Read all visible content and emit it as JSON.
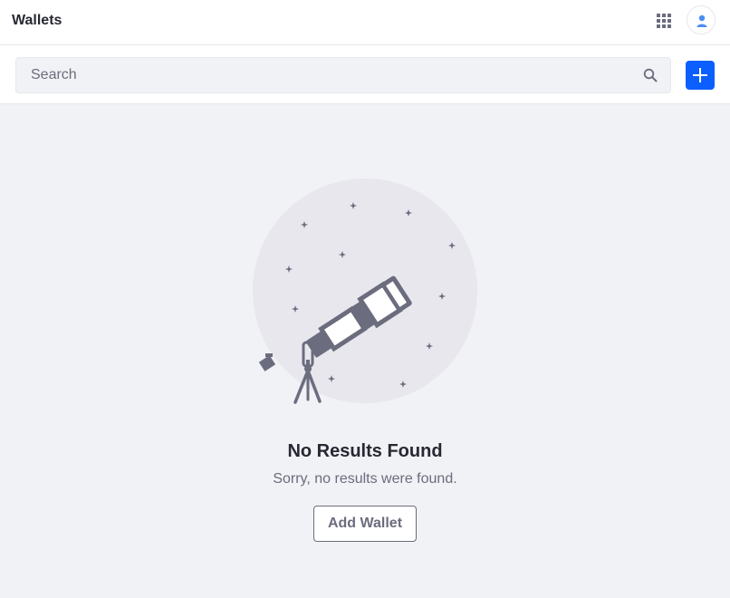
{
  "header": {
    "title": "Wallets",
    "apps_icon": "apps-grid-icon",
    "user_icon": "user-icon"
  },
  "toolbar": {
    "search_placeholder": "Search",
    "search_value": "",
    "search_icon": "search-icon",
    "add_icon": "plus-icon"
  },
  "empty_state": {
    "illustration": "telescope-stars-illustration",
    "title": "No Results Found",
    "description": "Sorry, no results were found.",
    "action_label": "Add Wallet"
  },
  "colors": {
    "primary": "#0b5fff",
    "background": "#f1f2f5",
    "text": "#272833",
    "secondary_text": "#6b6c7e"
  }
}
